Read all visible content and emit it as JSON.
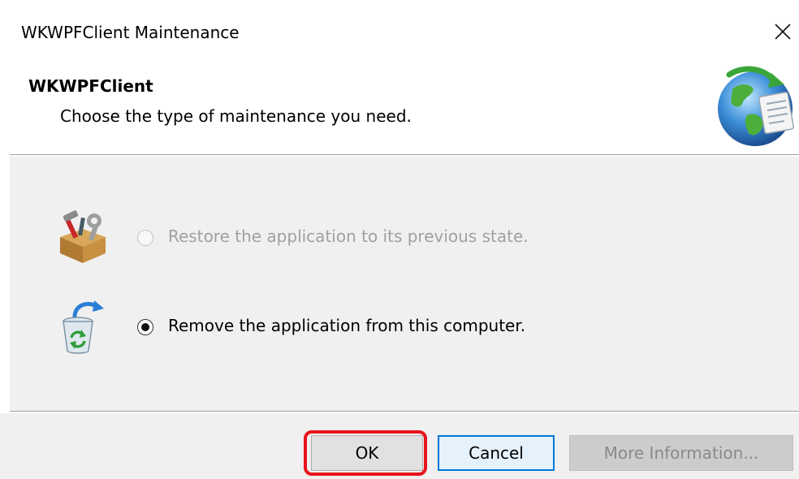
{
  "window": {
    "title": "WKWPFClient Maintenance",
    "close_glyph": "✕",
    "close_icon": "close-icon"
  },
  "header": {
    "app_name": "WKWPFClient",
    "subtitle": "Choose the type of maintenance you need.",
    "icon": "globe-installer-icon"
  },
  "options": [
    {
      "label": "Restore the application to its previous state.",
      "enabled": false,
      "selected": false,
      "icon": "toolbox-repair-icon"
    },
    {
      "label": "Remove the application from this computer.",
      "enabled": true,
      "selected": true,
      "icon": "recycle-bin-icon"
    }
  ],
  "buttons": {
    "ok": "OK",
    "cancel": "Cancel",
    "more_info": "More Information..."
  },
  "colors": {
    "highlight": "#e8141b",
    "focus_border": "#0078d7",
    "panel_bg": "#f0f0f0"
  }
}
